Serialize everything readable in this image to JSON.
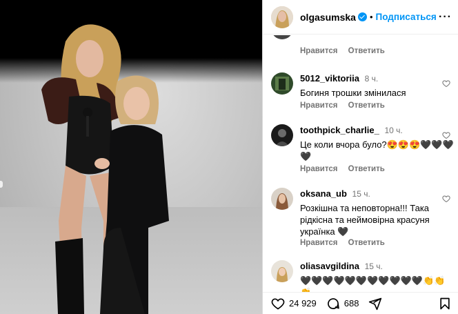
{
  "post": {
    "username": "olgasumska",
    "follow_label": "Подписаться",
    "dot": "•",
    "more": "···"
  },
  "comments": [
    {
      "username": "",
      "time": "",
      "text": "",
      "like_label": "Нравится",
      "reply_label": "Ответить"
    },
    {
      "username": "5012_viktoriia",
      "time": "8 ч.",
      "text": "Богиня трошки змінилася",
      "like_label": "Нравится",
      "reply_label": "Ответить"
    },
    {
      "username": "toothpick_charlie_",
      "time": "10 ч.",
      "text": "Це коли вчора було?😍😍😍🖤🖤🖤🖤",
      "like_label": "Нравится",
      "reply_label": "Ответить"
    },
    {
      "username": "oksana_ub",
      "time": "15 ч.",
      "text": "Розкішна та неповторна!!! Така рідкісна та неймовірна красуня українка 🖤",
      "like_label": "Нравится",
      "reply_label": "Ответить"
    },
    {
      "username": "oliasavgildina",
      "time": "15 ч.",
      "text": "🖤🖤🖤🖤🖤🖤🖤🖤🖤🖤🖤👏👏👏",
      "like_label": "",
      "reply_label": ""
    }
  ],
  "actions": {
    "likes": "24 929",
    "comments": "688"
  },
  "icons": {
    "like": "heart-icon",
    "comment": "comment-icon",
    "share": "share-icon",
    "save": "bookmark-icon",
    "verified": "verified-badge-icon"
  },
  "colors": {
    "accent": "#0095f6",
    "muted": "#737373"
  }
}
